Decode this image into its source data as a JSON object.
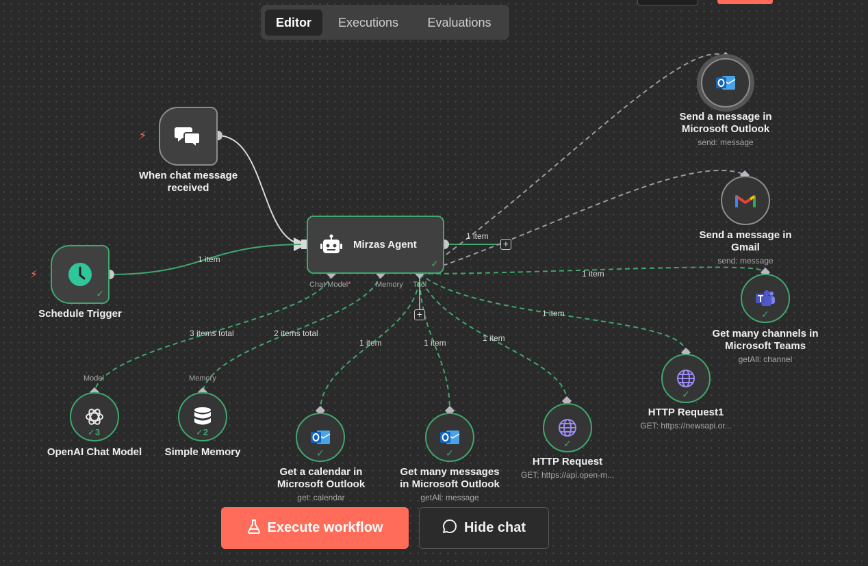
{
  "tabs": [
    {
      "label": "Editor",
      "active": true
    },
    {
      "label": "Executions",
      "active": false
    },
    {
      "label": "Evaluations",
      "active": false
    }
  ],
  "nodes": {
    "chat_trigger": {
      "label": "When chat message received",
      "icon": "chat-bubbles-icon"
    },
    "schedule_trigger": {
      "label": "Schedule Trigger",
      "icon": "clock-icon"
    },
    "agent": {
      "label": "Mirzas Agent",
      "icon": "robot-icon",
      "ports": {
        "chat_model": "Chat Model",
        "required_mark": "*",
        "memory": "Memory",
        "tool": "Tool"
      }
    },
    "openai": {
      "label": "OpenAI Chat Model",
      "port": "Model",
      "count": "3",
      "icon": "openai-icon"
    },
    "memory": {
      "label": "Simple Memory",
      "port": "Memory",
      "count": "2",
      "icon": "database-icon"
    },
    "outlook_calendar": {
      "label": "Get a calendar in Microsoft Outlook",
      "sub": "get: calendar",
      "icon": "outlook-icon"
    },
    "outlook_messages": {
      "label": "Get many messages in Microsoft Outlook",
      "sub": "getAll: message",
      "icon": "outlook-icon"
    },
    "http_request": {
      "label": "HTTP Request",
      "sub": "GET: https://api.open-m...",
      "icon": "globe-icon"
    },
    "http_request1": {
      "label": "HTTP Request1",
      "sub": "GET: https://newsapi.or...",
      "icon": "globe-icon"
    },
    "teams": {
      "label": "Get many channels in Microsoft Teams",
      "sub": "getAll: channel",
      "icon": "teams-icon"
    },
    "gmail": {
      "label": "Send a message in Gmail",
      "sub": "send: message",
      "icon": "gmail-icon"
    },
    "outlook_send": {
      "label": "Send a message in Microsoft Outlook",
      "sub": "send: message",
      "icon": "outlook-icon"
    }
  },
  "edge_labels": {
    "schedule_to_agent": "1 item",
    "agent_output": "1 item",
    "model": "3 items total",
    "memory": "2 items total",
    "calendar": "1 item",
    "messages": "1 item",
    "http": "1 item",
    "http1": "1 item",
    "teams": "1 item"
  },
  "buttons": {
    "execute": "Execute workflow",
    "hide_chat": "Hide chat"
  },
  "colors": {
    "accent": "#ff6d5a",
    "success": "#3fa86d",
    "canvas": "#2a2a2a",
    "node_fill": "#404040"
  }
}
